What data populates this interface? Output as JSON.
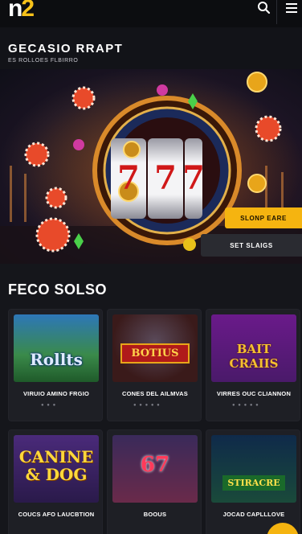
{
  "header": {
    "logo_left": "n",
    "logo_right": "2",
    "search_icon": "search-icon",
    "menu_icon": "hamburger-menu-icon"
  },
  "hero": {
    "title": "GECASIO RRAPT",
    "subtitle": "ES ROLLOES FLBIRRO",
    "reels": [
      "7",
      "7",
      "7"
    ],
    "primary_button": "SLONP EARE",
    "secondary_button": "SET SLAIGS"
  },
  "section": {
    "title": "FECO SOLSO"
  },
  "games": [
    {
      "thumb": "Rollts",
      "name": "VIRUIO AMINO FRGIO",
      "bg": "#2a6a3a"
    },
    {
      "thumb": "BOTIUS",
      "name": "CONES DEL AILMVAS",
      "bg": "#6e1a1a"
    },
    {
      "thumb": "BAIT CRAIIS",
      "name": "VIRRES OUC CLIANNON",
      "bg": "#5a2a6a"
    },
    {
      "thumb": "CANINE & DOG",
      "name": "COUCS AFO LAUCBTION",
      "bg": "#3a1f5a"
    },
    {
      "thumb": "67",
      "name": "BOOUS",
      "bg": "#4a2a4a"
    },
    {
      "thumb": "STIRACRE",
      "name": "JOCAD CAPLLLOVE",
      "bg": "#1a3a4a"
    }
  ],
  "colors": {
    "accent": "#f5b410",
    "background": "#15161b",
    "card": "#1e1f25"
  }
}
